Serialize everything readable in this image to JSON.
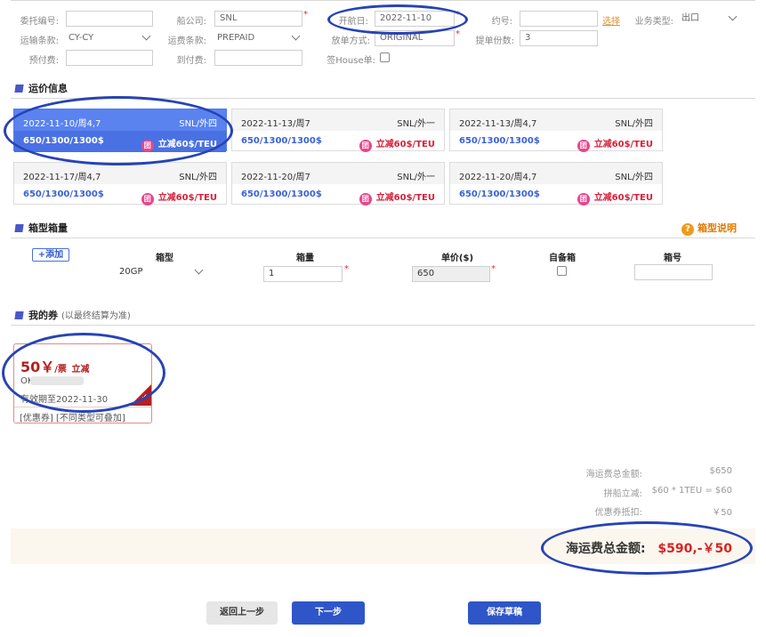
{
  "form": {
    "entrust_no": {
      "label": "委托编号:",
      "value": ""
    },
    "carrier": {
      "label": "船公司:",
      "value": "SNL"
    },
    "sail_date": {
      "label": "开航日:",
      "value": "2022-11-10"
    },
    "booking_no": {
      "label": "约号:",
      "value": "",
      "select_link": "选择"
    },
    "business_type": {
      "label": "业务类型:",
      "value": "出口"
    },
    "transport_terms": {
      "label": "运输条款:",
      "value": "CY-CY"
    },
    "freight_terms": {
      "label": "运费条款:",
      "value": "PREPAID"
    },
    "release_method": {
      "label": "放单方式:",
      "value": "ORIGINAL"
    },
    "bl_copies": {
      "label": "提单份数:",
      "value": "3"
    },
    "prepaid_fee": {
      "label": "预付费:",
      "value": ""
    },
    "collect_fee": {
      "label": "到付费:",
      "value": ""
    },
    "house_bl": {
      "label": "签House单:",
      "checked": false
    },
    "required_mark": "*"
  },
  "freight_section": {
    "title": "运价信息",
    "cards": [
      {
        "date": "2022-11-10/周4,7",
        "carrier": "SNL/外四",
        "price": "650/1300/1300$",
        "discount_icon": "团",
        "discount": "立减60$/TEU",
        "selected": true
      },
      {
        "date": "2022-11-13/周7",
        "carrier": "SNL/外一",
        "price": "650/1300/1300$",
        "discount_icon": "团",
        "discount": "立减60$/TEU",
        "selected": false
      },
      {
        "date": "2022-11-13/周4,7",
        "carrier": "SNL/外四",
        "price": "650/1300/1300$",
        "discount_icon": "团",
        "discount": "立减60$/TEU",
        "selected": false
      },
      {
        "date": "2022-11-17/周4,7",
        "carrier": "SNL/外四",
        "price": "650/1300/1300$",
        "discount_icon": "团",
        "discount": "立减60$/TEU",
        "selected": false
      },
      {
        "date": "2022-11-20/周7",
        "carrier": "SNL/外一",
        "price": "650/1300/1300$",
        "discount_icon": "团",
        "discount": "立减60$/TEU",
        "selected": false
      },
      {
        "date": "2022-11-20/周4,7",
        "carrier": "SNL/外四",
        "price": "650/1300/1300$",
        "discount_icon": "团",
        "discount": "立减60$/TEU",
        "selected": false
      }
    ]
  },
  "container_section": {
    "title": "箱型箱量",
    "help_icon": "?",
    "help_text": "箱型说明",
    "add_button": "+添加",
    "headers": {
      "type": "箱型",
      "qty": "箱量",
      "unit_price": "单价($)",
      "own_box": "自备箱",
      "box_no": "箱号"
    },
    "row": {
      "type": "20GP",
      "qty": "1",
      "unit_price": "650",
      "own_box": false,
      "box_no": ""
    }
  },
  "coupon_section": {
    "title": "我的券",
    "subtitle": "(以最终结算为准)",
    "coupon": {
      "amount": "50￥",
      "unit": "/票",
      "type": "立减",
      "code": "OK",
      "valid_until": "有效期至2022-11-30",
      "tags": "[优惠券] [不同类型可叠加]",
      "check_mark": "✓"
    }
  },
  "summary": {
    "ocean_total_label": "海运费总金额:",
    "ocean_total_value": "$650",
    "group_discount_label": "拼船立减:",
    "group_discount_value": "$60 * 1TEU = $60",
    "coupon_label": "优惠券抵扣:",
    "coupon_value": "￥50",
    "final_label": "海运费总金额:",
    "final_value": "$590,-￥50"
  },
  "buttons": {
    "back": "返回上一步",
    "next": "下一步",
    "save_draft": "保存草稿"
  },
  "colors": {
    "accent": "#2f56c8",
    "selected_card": "#5a83f0",
    "discount_red": "#d8203a",
    "annotation_ring": "#2743b5"
  }
}
